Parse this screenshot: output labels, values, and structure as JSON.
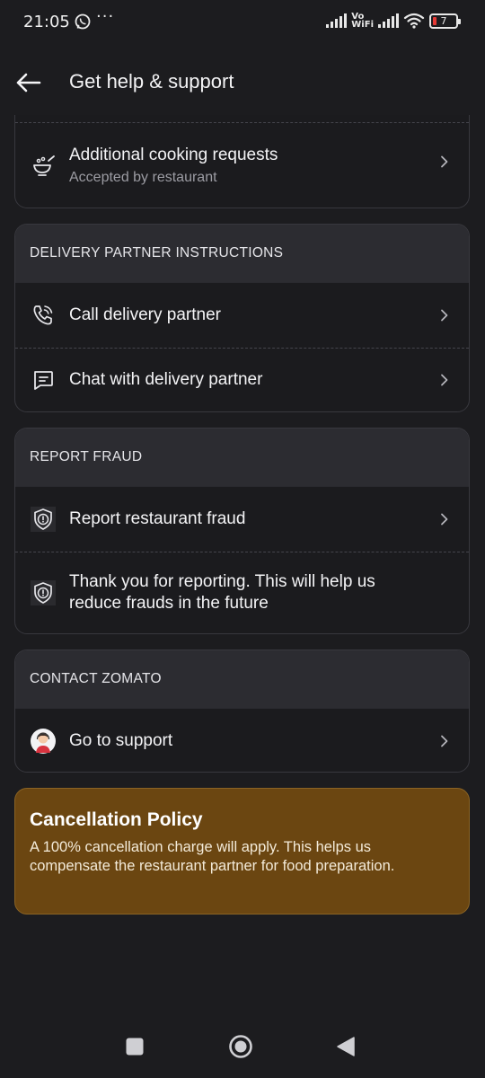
{
  "status_bar": {
    "time": "21:05",
    "dots": "···",
    "vowifi_top": "Vo",
    "vowifi_bottom": "WiFi",
    "battery": "7"
  },
  "header": {
    "title": "Get help & support"
  },
  "order_card": {
    "items": [
      {
        "label": "Additional cooking requests",
        "sub": "Accepted by restaurant"
      }
    ]
  },
  "delivery_section": {
    "title": "DELIVERY PARTNER INSTRUCTIONS",
    "items": [
      {
        "label": "Call delivery partner"
      },
      {
        "label": "Chat with delivery partner"
      }
    ]
  },
  "fraud_section": {
    "title": "REPORT FRAUD",
    "items": [
      {
        "label": "Report restaurant fraud"
      },
      {
        "label": "Thank you for reporting. This will help us reduce frauds in the future"
      }
    ]
  },
  "contact_section": {
    "title": "CONTACT ZOMATO",
    "items": [
      {
        "label": "Go to support"
      }
    ]
  },
  "policy": {
    "title": "Cancellation Policy",
    "body": "A 100% cancellation charge will apply. This helps us compensate the restaurant partner for food preparation."
  },
  "colors": {
    "background": "#1c1c1f",
    "section_header": "#2c2c31",
    "policy_bg": "#6b4611",
    "battery_low": "#e53935"
  },
  "icons": [
    "whatsapp-icon",
    "back-arrow-icon",
    "cooking-bowl-icon",
    "phone-icon",
    "chat-icon",
    "shield-alert-icon",
    "support-avatar-icon",
    "chevron-right-icon",
    "nav-recents-icon",
    "nav-home-icon",
    "nav-back-icon"
  ]
}
